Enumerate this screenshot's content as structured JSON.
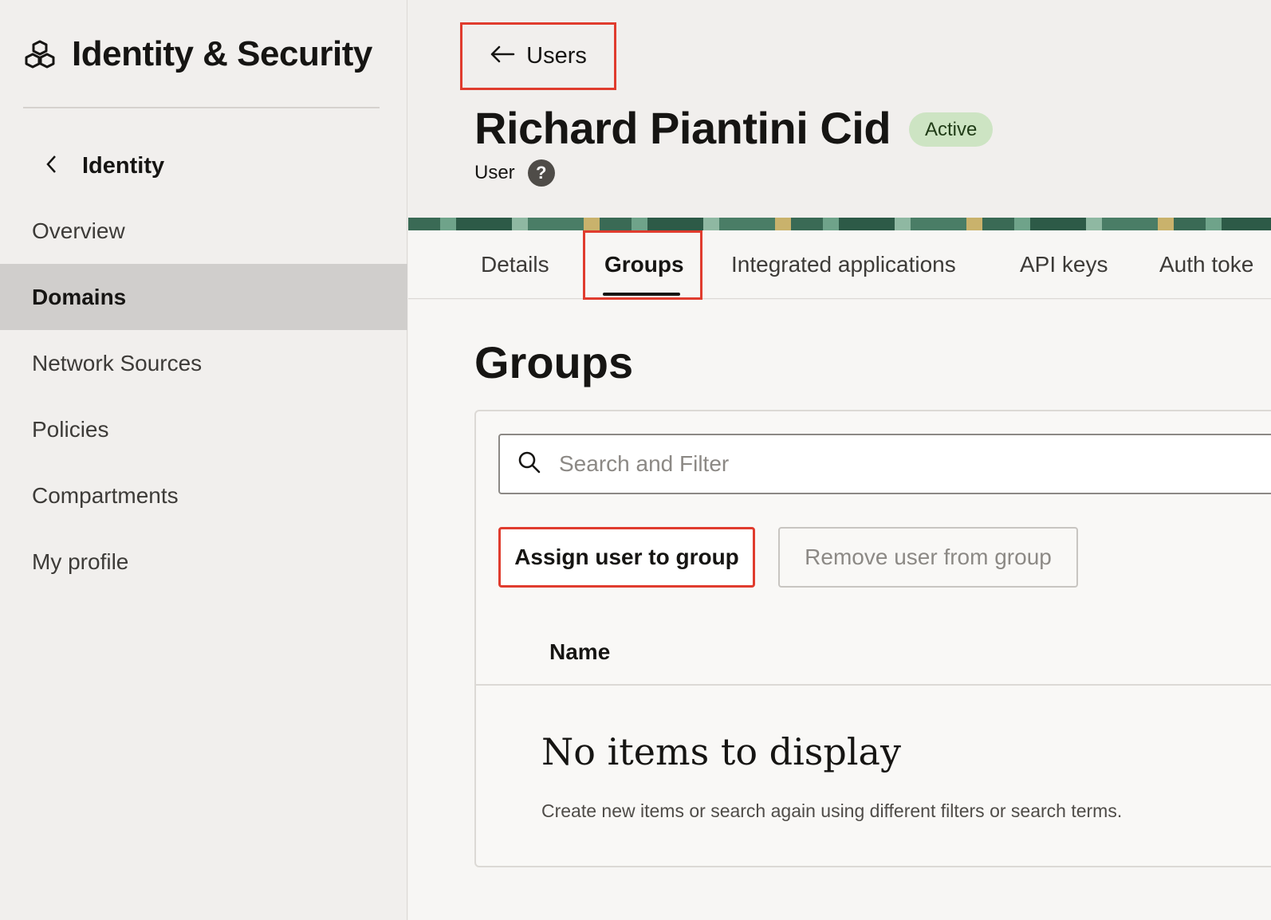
{
  "app": {
    "title": "Identity & Security",
    "logo_icon": "cubes-icon"
  },
  "sidebar": {
    "back_label": "Identity",
    "items": [
      {
        "label": "Overview",
        "active": false
      },
      {
        "label": "Domains",
        "active": true
      },
      {
        "label": "Network Sources",
        "active": false
      },
      {
        "label": "Policies",
        "active": false
      },
      {
        "label": "Compartments",
        "active": false
      },
      {
        "label": "My profile",
        "active": false
      }
    ]
  },
  "header": {
    "back_link": "Users",
    "user_name": "Richard Piantini Cid",
    "status": "Active",
    "subtitle": "User",
    "help": "?"
  },
  "tabs": [
    {
      "label": "Details",
      "active": false
    },
    {
      "label": "Groups",
      "active": true
    },
    {
      "label": "Integrated applications",
      "active": false
    },
    {
      "label": "API keys",
      "active": false
    },
    {
      "label": "Auth toke",
      "active": false
    }
  ],
  "groups": {
    "title": "Groups",
    "search": {
      "placeholder": "Search and Filter",
      "value": ""
    },
    "assign_button": "Assign user to group",
    "remove_button": "Remove user from group",
    "columns": [
      "Name"
    ],
    "empty_title": "No items to display",
    "empty_desc": "Create new items or search again using different filters or search terms."
  },
  "colors": {
    "accent_highlight": "#e03c2e",
    "status_bg": "#cde4c3",
    "sidebar_active": "#d0cecc"
  }
}
